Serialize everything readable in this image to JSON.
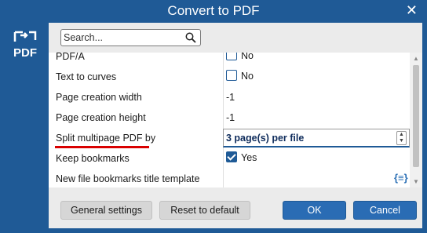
{
  "window": {
    "title": "Convert to PDF"
  },
  "search": {
    "placeholder": "Search..."
  },
  "rows": [
    {
      "label": "PDF/A",
      "value": "No"
    },
    {
      "label": "Text to curves",
      "value": "No"
    },
    {
      "label": "Page creation width",
      "value": "-1"
    },
    {
      "label": "Page creation height",
      "value": "-1"
    },
    {
      "label": "Split multipage PDF by",
      "value": "3 page(s) per file"
    },
    {
      "label": "Keep bookmarks",
      "value": "Yes"
    },
    {
      "label": "New file bookmarks title template",
      "value": ""
    }
  ],
  "buttons": {
    "general_settings": "General settings",
    "reset": "Reset to default",
    "ok": "OK",
    "cancel": "Cancel"
  },
  "icons": {
    "logo": "pdf-convert-icon",
    "search": "search-icon",
    "close": "close-icon",
    "template": "template-braces-icon"
  },
  "colors": {
    "titlebar": "#1f5a96",
    "accent": "#2a6cb4",
    "highlight": "#d90000"
  }
}
